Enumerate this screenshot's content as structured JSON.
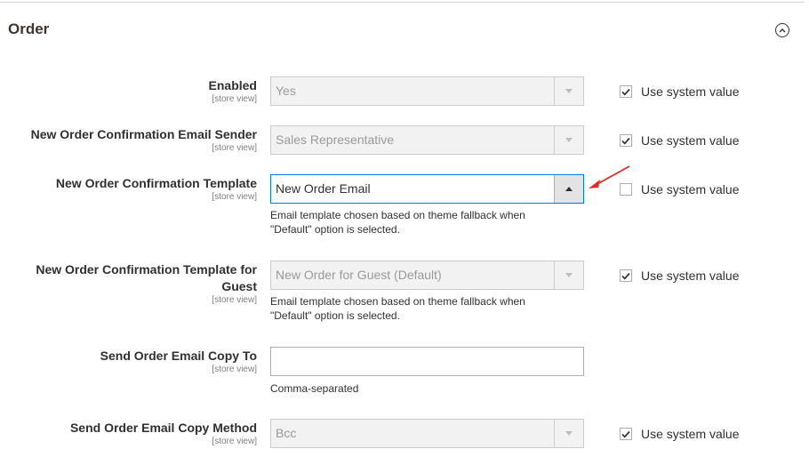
{
  "section": {
    "title": "Order"
  },
  "fields": [
    {
      "label": "Enabled",
      "scope": "[store view]",
      "value": "Yes",
      "use_system_value": true
    },
    {
      "label": "New Order Confirmation Email Sender",
      "scope": "[store view]",
      "value": "Sales Representative",
      "use_system_value": true
    },
    {
      "label": "New Order Confirmation Template",
      "scope": "[store view]",
      "value": "New Order Email",
      "note": "Email template chosen based on theme fallback when \"Default\" option is selected.",
      "use_system_value": false
    },
    {
      "label": "New Order Confirmation Template for Guest",
      "scope": "[store view]",
      "value": "New Order for Guest (Default)",
      "note": "Email template chosen based on theme fallback when \"Default\" option is selected.",
      "use_system_value": true
    },
    {
      "label": "Send Order Email Copy To",
      "scope": "[store view]",
      "value": "",
      "note": "Comma-separated"
    },
    {
      "label": "Send Order Email Copy Method",
      "scope": "[store view]",
      "value": "Bcc",
      "use_system_value": true
    }
  ],
  "system_value_label": "Use system value",
  "colors": {
    "focus_border": "#007bdb",
    "annotation_arrow": "#e02b27"
  },
  "icons": {
    "collapse": "collapse-circle-up-icon",
    "annotation": "red-arrow-icon"
  }
}
